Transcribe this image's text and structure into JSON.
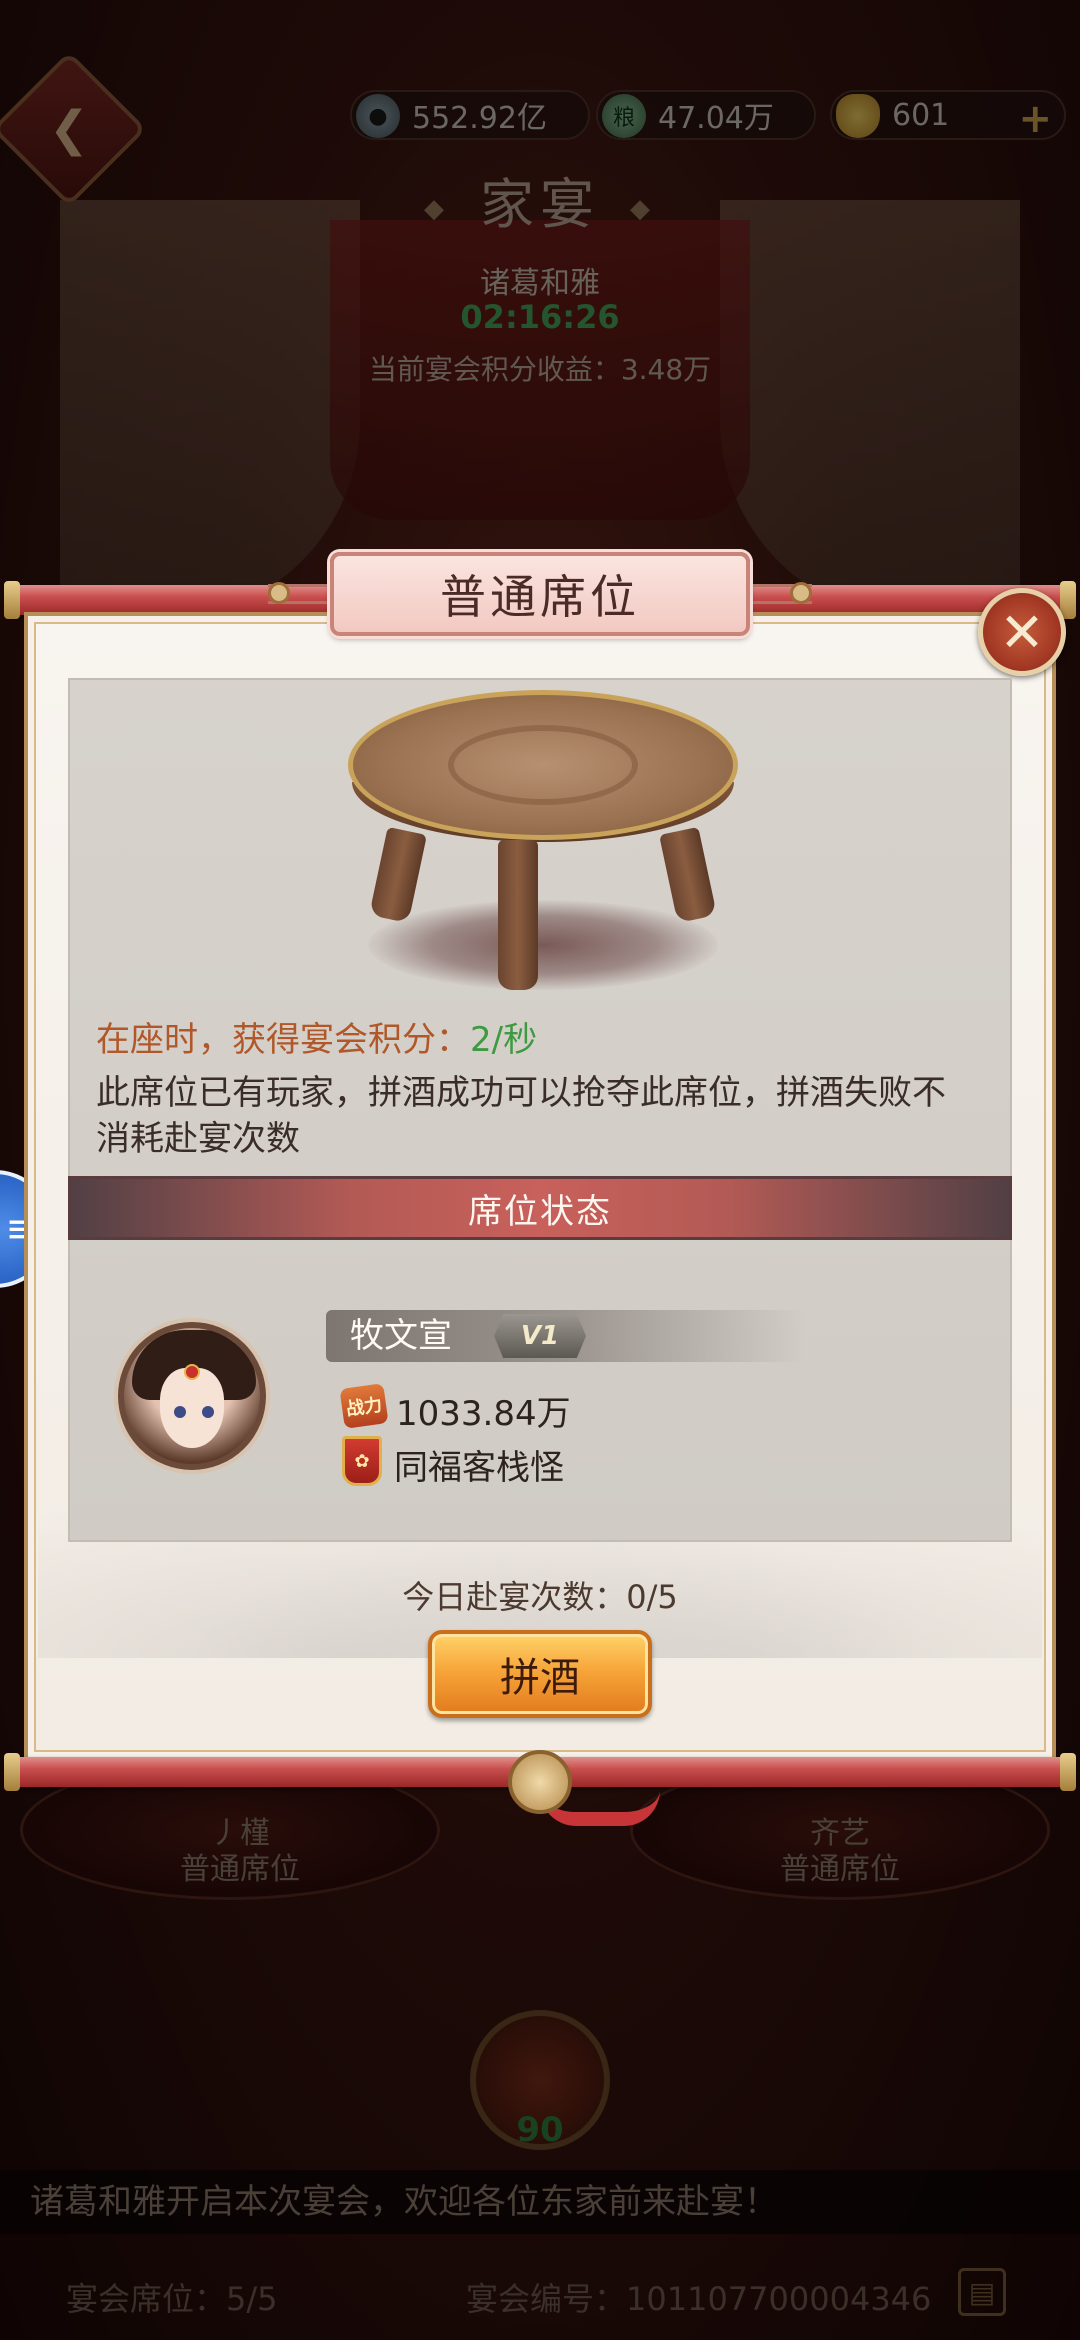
{
  "hud": {
    "back_icon": "back-arrow-icon",
    "resources": [
      {
        "icon": "coin-icon",
        "value": "552.92亿"
      },
      {
        "icon": "grain-icon",
        "icon_text": "粮",
        "value": "47.04万"
      },
      {
        "icon": "gold-ingot-icon",
        "value": "601"
      }
    ],
    "add_label": "+"
  },
  "feast": {
    "title": "家宴",
    "host": "诸葛和雅",
    "timer": "02:16:26",
    "income_label": "当前宴会积分收益：3.48万"
  },
  "background_seats": [
    {
      "name": "丿槿",
      "type": "普通席位"
    },
    {
      "name": "齐艺",
      "type": "普通席位"
    }
  ],
  "modal": {
    "title": "普通席位",
    "close_icon": "close-x-icon",
    "score_prefix": "在座时，获得宴会积分：",
    "score_value": "2/秒",
    "description": "此席位已有玩家，拼酒成功可以抢夺此席位，拼酒失败不消耗赴宴次数",
    "status_header": "席位状态",
    "occupant": {
      "name": "牧文宣",
      "vip": "V1",
      "power_icon_text": "战力",
      "power": "1033.84万",
      "guild": "同福客栈怪"
    },
    "attend_label": "今日赴宴次数：0/5",
    "action_button": "拼酒"
  },
  "center_emblem_value": "90",
  "ticker": "诸葛和雅开启本次宴会，欢迎各位东家前来赴宴！",
  "footer": {
    "seats": "宴会席位：5/5",
    "feast_id": "宴会编号：101107700004346",
    "doc_icon": "document-icon"
  },
  "colors": {
    "accent_red": "#c84e4d",
    "button_orange": "#f7a63a",
    "score_green": "#3e9a41",
    "score_label": "#b1582a"
  }
}
